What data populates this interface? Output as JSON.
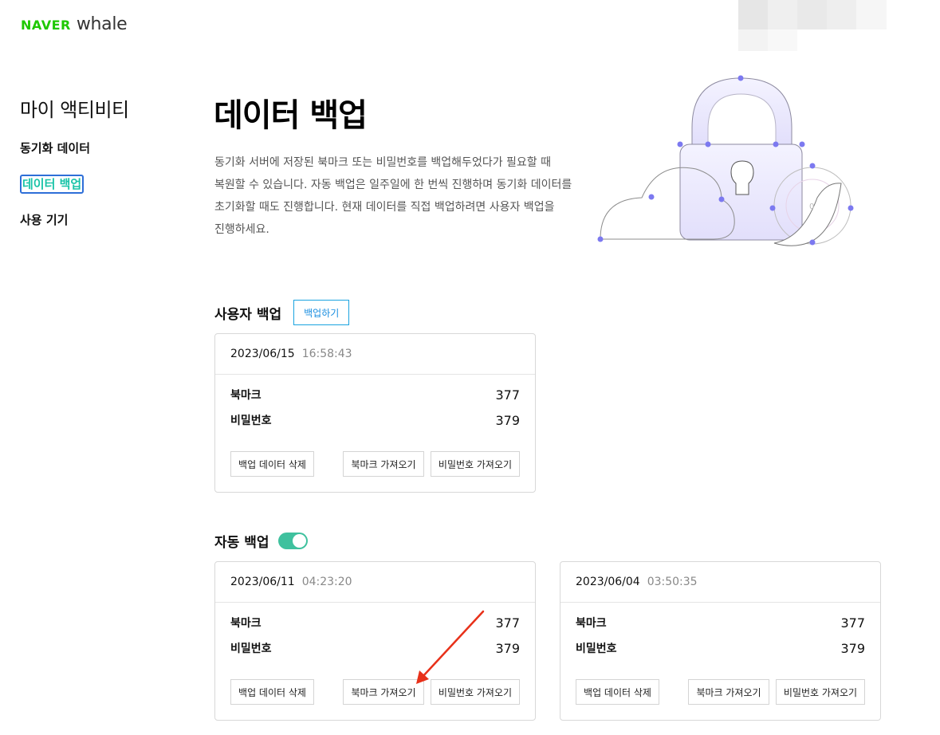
{
  "brand": {
    "naver": "NAVER",
    "whale": "whale"
  },
  "sidebar": {
    "title": "마이 액티비티",
    "items": [
      {
        "label": "동기화 데이터"
      },
      {
        "label": "데이터 백업"
      },
      {
        "label": "사용 기기"
      }
    ]
  },
  "main": {
    "title": "데이터 백업",
    "description": "동기화 서버에 저장된 북마크 또는 비밀번호를 백업해두었다가 필요할 때 복원할 수 있습니다. 자동 백업은 일주일에 한 번씩 진행하며 동기화 데이터를 초기화할 때도 진행합니다. 현재 데이터를 직접 백업하려면 사용자 백업을 진행하세요."
  },
  "user_backup": {
    "heading": "사용자 백업",
    "button_label": "백업하기",
    "card": {
      "date": "2023/06/15",
      "time": "16:58:43",
      "bookmark_label": "북마크",
      "bookmark_count": "377",
      "password_label": "비밀번호",
      "password_count": "379",
      "delete_label": "백업 데이터 삭제",
      "import_bookmark_label": "북마크 가져오기",
      "import_password_label": "비밀번호 가져오기"
    }
  },
  "auto_backup": {
    "heading": "자동 백업",
    "toggle_on": true,
    "cards": [
      {
        "date": "2023/06/11",
        "time": "04:23:20",
        "bookmark_label": "북마크",
        "bookmark_count": "377",
        "password_label": "비밀번호",
        "password_count": "379",
        "delete_label": "백업 데이터 삭제",
        "import_bookmark_label": "북마크 가져오기",
        "import_password_label": "비밀번호 가져오기"
      },
      {
        "date": "2023/06/04",
        "time": "03:50:35",
        "bookmark_label": "북마크",
        "bookmark_count": "377",
        "password_label": "비밀번호",
        "password_count": "379",
        "delete_label": "백업 데이터 삭제",
        "import_bookmark_label": "북마크 가져오기",
        "import_password_label": "비밀번호 가져오기"
      }
    ]
  },
  "colors": {
    "brand_green": "#1ec800",
    "active_teal": "#19c3a8",
    "toggle_green": "#3fc19e",
    "link_blue": "#1a8ee0",
    "annotation_red": "#e8311a"
  }
}
